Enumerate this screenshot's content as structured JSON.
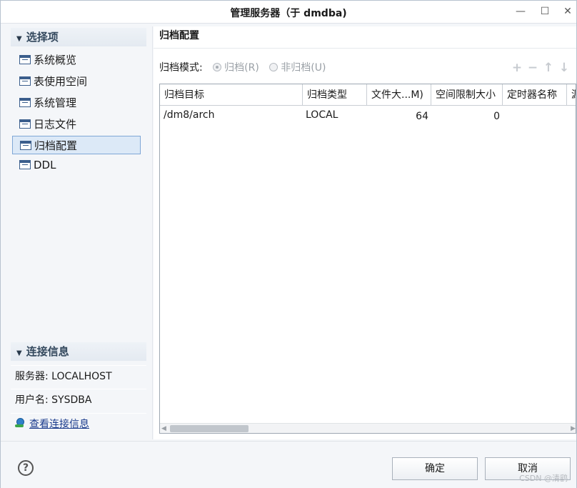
{
  "window": {
    "title": "管理服务器（于 dmdba)"
  },
  "sidebar": {
    "options_header": "选择项",
    "items": [
      {
        "label": "系统概览"
      },
      {
        "label": "表使用空间"
      },
      {
        "label": "系统管理"
      },
      {
        "label": "日志文件"
      },
      {
        "label": "归档配置"
      },
      {
        "label": "DDL"
      }
    ],
    "selected": "归档配置",
    "conn_header": "连接信息",
    "server_label": "服务器: LOCALHOST",
    "user_label": "用户名: SYSDBA",
    "view_link": "查看连接信息"
  },
  "main": {
    "title": "归档配置",
    "mode_label": "归档模式:",
    "radio_archive": "归档(R)",
    "radio_noarchive": "非归档(U)",
    "columns": [
      "归档目标",
      "归档类型",
      "文件大...M)",
      "空间限制大小",
      "定时器名称",
      "源"
    ],
    "rows": [
      [
        "/dm8/arch",
        "LOCAL",
        "64",
        "0",
        "",
        ""
      ]
    ]
  },
  "footer": {
    "ok_label": "确定",
    "cancel_label": "取消",
    "watermark": "CSDN @清鹞"
  }
}
